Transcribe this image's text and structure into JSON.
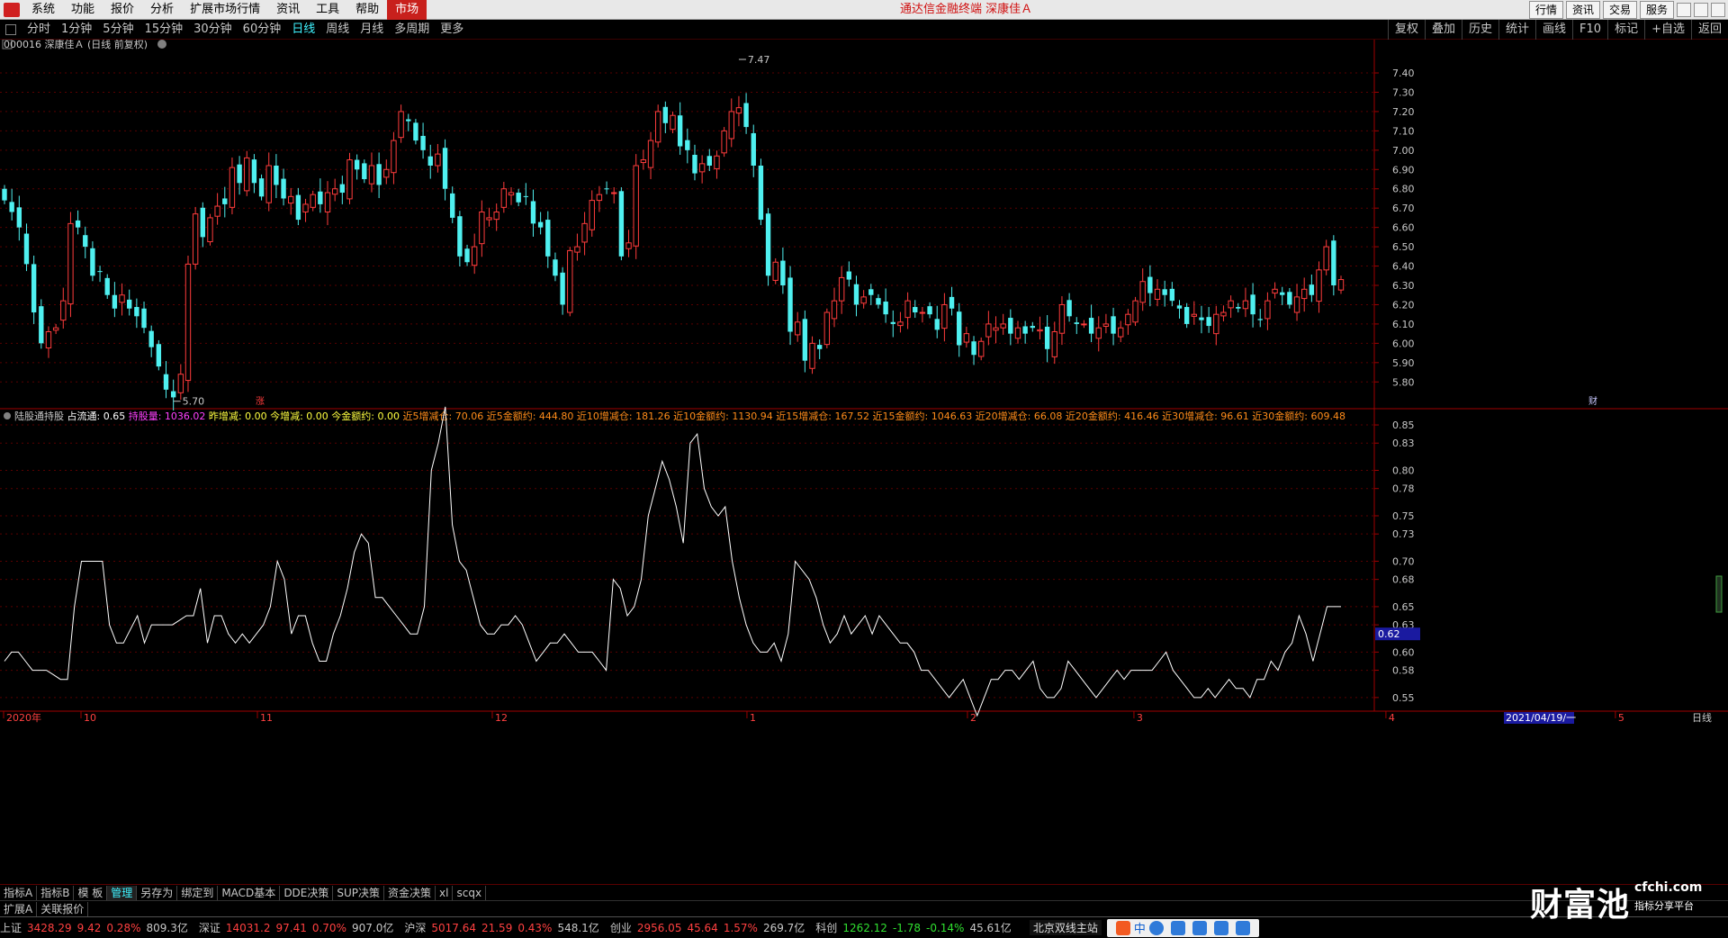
{
  "menubar": {
    "items": [
      "系统",
      "功能",
      "报价",
      "分析",
      "扩展市场行情",
      "资讯",
      "工具",
      "帮助",
      "市场"
    ],
    "active_index": 8,
    "window_title": "通达信金融终端  深康佳Ａ",
    "right_buttons": [
      "行情",
      "资讯",
      "交易",
      "服务"
    ]
  },
  "periodbar": {
    "periods": [
      "分时",
      "1分钟",
      "5分钟",
      "15分钟",
      "30分钟",
      "60分钟",
      "日线",
      "周线",
      "月线",
      "多周期",
      "更多"
    ],
    "active_index": 6,
    "tools": [
      "复权",
      "叠加",
      "历史",
      "统计",
      "画线",
      "F10",
      "标记",
      "+自选",
      "返回"
    ]
  },
  "main_chart": {
    "title": "000016 深康佳Ａ (日线 前复权)",
    "high_label": "7.47",
    "low_label": "5.70",
    "badge_zhang": "涨",
    "badge_cai": "财",
    "y_ticks": [
      "7.40",
      "7.30",
      "7.20",
      "7.10",
      "7.00",
      "6.90",
      "6.80",
      "6.70",
      "6.60",
      "6.50",
      "6.40",
      "6.30",
      "6.20",
      "6.10",
      "6.00",
      "5.90",
      "5.80"
    ]
  },
  "indicator": {
    "name": "陆股通持股",
    "fields": [
      {
        "label": "占流通:",
        "value": "0.65",
        "color": "#ffffff"
      },
      {
        "label": "持股量:",
        "value": "1036.02",
        "color": "#ff40ff"
      },
      {
        "label": "昨增减:",
        "value": "0.00",
        "color": "#ffff40"
      },
      {
        "label": "今增减:",
        "value": "0.00",
        "color": "#ffff40"
      },
      {
        "label": "今金额约:",
        "value": "0.00",
        "color": "#ffff40"
      },
      {
        "label": "近5增减仓:",
        "value": "70.06",
        "color": "#ff8c1a"
      },
      {
        "label": "近5金额约:",
        "value": "444.80",
        "color": "#ff8c1a"
      },
      {
        "label": "近10增减仓:",
        "value": "181.26",
        "color": "#ff8c1a"
      },
      {
        "label": "近10金额约:",
        "value": "1130.94",
        "color": "#ff8c1a"
      },
      {
        "label": "近15增减仓:",
        "value": "167.52",
        "color": "#ff8c1a"
      },
      {
        "label": "近15金额约:",
        "value": "1046.63",
        "color": "#ff8c1a"
      },
      {
        "label": "近20增减仓:",
        "value": "66.08",
        "color": "#ff8c1a"
      },
      {
        "label": "近20金额约:",
        "value": "416.46",
        "color": "#ff8c1a"
      },
      {
        "label": "近30增减仓:",
        "value": "96.61",
        "color": "#ff8c1a"
      },
      {
        "label": "近30金额约:",
        "value": "609.48",
        "color": "#ff8c1a"
      }
    ],
    "y_ticks": [
      "0.85",
      "0.83",
      "0.80",
      "0.78",
      "0.75",
      "0.73",
      "0.70",
      "0.68",
      "0.65",
      "0.63",
      "0.60",
      "0.58",
      "0.55"
    ],
    "current_value_label": "0.62"
  },
  "time_axis": {
    "labels": [
      "2020年",
      "10",
      "11",
      "12",
      "1",
      "2",
      "3",
      "4",
      "5"
    ],
    "cursor_date": "2021/04/19/一",
    "period_label": "日线"
  },
  "tabs": [
    "指标A",
    "指标B",
    "模 板",
    "管理",
    "另存为",
    "绑定到",
    "MACD基本",
    "DDE决策",
    "SUP决策",
    "资金决策",
    "xl",
    "scqx"
  ],
  "active_tab_index": 3,
  "subtabs": [
    "扩展A",
    "关联报价"
  ],
  "status": {
    "indices": [
      {
        "name": "上证",
        "value": "3428.29",
        "change": "9.42",
        "pct": "0.28%",
        "amount": "809.3亿",
        "dir": "up"
      },
      {
        "name": "深证",
        "value": "14031.2",
        "change": "97.41",
        "pct": "0.70%",
        "amount": "907.0亿",
        "dir": "up"
      },
      {
        "name": "沪深",
        "value": "5017.64",
        "change": "21.59",
        "pct": "0.43%",
        "amount": "548.1亿",
        "dir": "up"
      },
      {
        "name": "创业",
        "value": "2956.05",
        "change": "45.64",
        "pct": "1.57%",
        "amount": "269.7亿",
        "dir": "up"
      },
      {
        "name": "科创",
        "value": "1262.12",
        "change": "-1.78",
        "pct": "-0.14%",
        "amount": "45.61亿",
        "dir": "dn"
      }
    ],
    "server": "北京双线主站",
    "ime_char": "中"
  },
  "watermark": {
    "brand": "财富池",
    "site": "cfchi.com",
    "tagline": "指标分享平台"
  },
  "chart_data": [
    {
      "type": "candlestick",
      "title": "000016 深康佳Ａ (日线 前复权)",
      "ylim": [
        5.75,
        7.47
      ],
      "high": 7.47,
      "low": 5.7,
      "x_labels": [
        "2020年",
        "10",
        "11",
        "12",
        "1",
        "2",
        "3",
        "4",
        "5"
      ],
      "close": [
        6.74,
        6.68,
        6.6,
        6.41,
        6.16,
        6.0,
        6.06,
        6.08,
        6.22,
        6.62,
        6.6,
        6.5,
        6.35,
        6.37,
        6.25,
        6.18,
        6.25,
        6.18,
        6.14,
        6.08,
        5.98,
        5.88,
        5.76,
        5.72,
        5.84,
        6.41,
        6.67,
        6.55,
        6.65,
        6.71,
        6.72,
        6.91,
        6.83,
        6.96,
        6.83,
        6.76,
        6.92,
        6.82,
        6.75,
        6.76,
        6.64,
        6.72,
        6.77,
        6.72,
        6.78,
        6.8,
        6.78,
        6.95,
        6.9,
        6.85,
        6.92,
        6.82,
        6.9,
        7.05,
        7.2,
        7.15,
        7.05,
        7.0,
        6.92,
        6.98,
        6.8,
        6.65,
        6.45,
        6.42,
        6.5,
        6.68,
        6.65,
        6.68,
        6.8,
        6.78,
        6.73,
        6.76,
        6.62,
        6.6,
        6.45,
        6.35,
        6.2,
        6.48,
        6.5,
        6.62,
        6.74,
        6.77,
        6.8,
        6.78,
        6.45,
        6.52,
        6.92,
        6.95,
        7.05,
        7.2,
        7.14,
        7.18,
        7.02,
        7.0,
        6.88,
        6.93,
        6.92,
        6.97,
        7.1,
        7.2,
        7.22,
        7.12,
        6.92,
        6.64,
        6.35,
        6.42,
        6.3,
        6.06,
        6.11,
        5.91,
        6.0,
        5.97,
        6.16,
        6.22,
        6.34,
        6.33,
        6.2,
        6.24,
        6.25,
        6.2,
        6.15,
        6.1,
        6.11,
        6.22,
        6.16,
        6.16,
        6.15,
        6.07,
        6.2,
        6.18,
        5.99,
        6.05,
        5.94,
        6.01,
        6.1,
        6.08,
        6.1,
        6.05,
        6.08,
        6.05,
        6.08,
        6.07,
        5.97,
        6.06,
        6.2,
        6.14,
        6.1,
        6.1,
        6.05,
        6.08,
        6.1,
        6.05,
        6.08,
        6.15,
        6.22,
        6.32,
        6.26,
        6.28,
        6.25,
        6.22,
        6.18,
        6.1,
        6.15,
        6.12,
        6.09,
        6.15,
        6.16,
        6.22,
        6.18,
        6.22,
        6.15,
        6.12,
        6.22,
        6.28,
        6.25,
        6.2,
        6.24,
        6.28,
        6.25,
        6.38,
        6.5,
        6.3,
        6.33
      ]
    },
    {
      "type": "line",
      "title": "陆股通持股",
      "ylabel": "占流通",
      "ylim": [
        0.535,
        0.855
      ],
      "values": [
        0.59,
        0.6,
        0.6,
        0.59,
        0.58,
        0.58,
        0.58,
        0.575,
        0.57,
        0.57,
        0.65,
        0.7,
        0.7,
        0.7,
        0.7,
        0.63,
        0.61,
        0.61,
        0.625,
        0.64,
        0.61,
        0.63,
        0.63,
        0.63,
        0.63,
        0.635,
        0.64,
        0.64,
        0.67,
        0.61,
        0.64,
        0.64,
        0.62,
        0.61,
        0.62,
        0.61,
        0.62,
        0.63,
        0.65,
        0.7,
        0.68,
        0.62,
        0.64,
        0.64,
        0.61,
        0.59,
        0.59,
        0.62,
        0.64,
        0.67,
        0.71,
        0.73,
        0.72,
        0.66,
        0.66,
        0.65,
        0.64,
        0.63,
        0.62,
        0.62,
        0.65,
        0.8,
        0.83,
        0.87,
        0.74,
        0.7,
        0.69,
        0.66,
        0.63,
        0.62,
        0.62,
        0.63,
        0.63,
        0.64,
        0.63,
        0.61,
        0.59,
        0.6,
        0.61,
        0.61,
        0.62,
        0.61,
        0.6,
        0.6,
        0.6,
        0.59,
        0.58,
        0.68,
        0.67,
        0.64,
        0.65,
        0.68,
        0.75,
        0.78,
        0.81,
        0.79,
        0.76,
        0.72,
        0.83,
        0.84,
        0.78,
        0.76,
        0.75,
        0.76,
        0.7,
        0.66,
        0.63,
        0.61,
        0.6,
        0.6,
        0.61,
        0.59,
        0.62,
        0.7,
        0.69,
        0.68,
        0.66,
        0.63,
        0.61,
        0.62,
        0.64,
        0.62,
        0.63,
        0.64,
        0.62,
        0.64,
        0.63,
        0.62,
        0.61,
        0.61,
        0.6,
        0.58,
        0.58,
        0.57,
        0.56,
        0.55,
        0.56,
        0.57,
        0.55,
        0.53,
        0.55,
        0.57,
        0.57,
        0.58,
        0.58,
        0.57,
        0.58,
        0.59,
        0.56,
        0.55,
        0.55,
        0.56,
        0.59,
        0.58,
        0.57,
        0.56,
        0.55,
        0.56,
        0.57,
        0.58,
        0.57,
        0.58,
        0.58,
        0.58,
        0.58,
        0.59,
        0.6,
        0.58,
        0.57,
        0.56,
        0.55,
        0.55,
        0.56,
        0.55,
        0.56,
        0.57,
        0.56,
        0.56,
        0.55,
        0.57,
        0.57,
        0.59,
        0.58,
        0.6,
        0.61,
        0.64,
        0.62,
        0.59,
        0.62,
        0.65,
        0.65,
        0.65
      ]
    }
  ]
}
